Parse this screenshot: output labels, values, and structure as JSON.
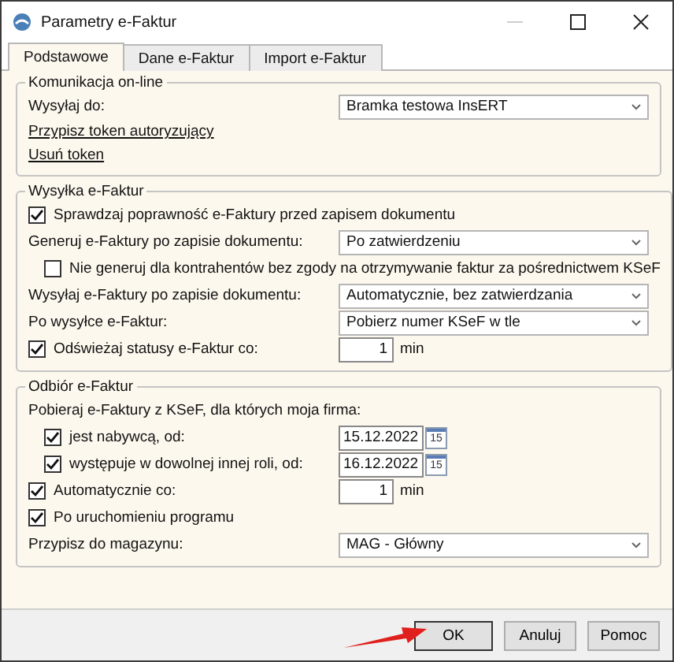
{
  "window": {
    "title": "Parametry e-Faktur"
  },
  "tabs": [
    {
      "label": "Podstawowe",
      "selected": true
    },
    {
      "label": "Dane e-Faktur",
      "selected": false
    },
    {
      "label": "Import e-Faktur",
      "selected": false
    }
  ],
  "sections": [
    {
      "title": "Komunikacja on-line",
      "rows": [
        {
          "kind": "select",
          "label": "Wysyłaj do:",
          "value": "Bramka testowa InsERT"
        },
        {
          "kind": "link",
          "label": "Przypisz token autoryzujący"
        },
        {
          "kind": "link",
          "label": "Usuń token"
        }
      ]
    },
    {
      "title": "Wysyłka e-Faktur",
      "rows": [
        {
          "kind": "checkbox",
          "label": "Sprawdzaj poprawność e-Faktury przed zapisem dokumentu",
          "checked": true
        },
        {
          "kind": "select",
          "label": "Generuj e-Faktury po zapisie dokumentu:",
          "value": "Po zatwierdzeniu"
        },
        {
          "kind": "checkbox",
          "indent": true,
          "label": "Nie generuj dla kontrahentów bez zgody na otrzymywanie faktur za pośrednictwem KSeF",
          "checked": false
        },
        {
          "kind": "select",
          "label": "Wysyłaj e-Faktury po zapisie dokumentu:",
          "value": "Automatycznie, bez zatwierdzania"
        },
        {
          "kind": "select",
          "label": "Po wysyłce e-Faktur:",
          "value": "Pobierz numer KSeF w tle"
        },
        {
          "kind": "number",
          "label": "Odświeżaj statusy e-Faktur co:",
          "checked": true,
          "value": "1",
          "unit": "min"
        }
      ]
    },
    {
      "title": "Odbiór  e-Faktur",
      "rows": [
        {
          "kind": "label",
          "label": "Pobieraj e-Faktury z KSeF, dla których moja firma:"
        },
        {
          "kind": "date",
          "indent": true,
          "label": "jest nabywcą, od:",
          "checked": true,
          "value": "15.12.2022",
          "icon_text": "15"
        },
        {
          "kind": "date",
          "indent": true,
          "label": "występuje w dowolnej innej roli, od:",
          "checked": true,
          "value": "16.12.2022",
          "icon_text": "15"
        },
        {
          "kind": "number",
          "label": "Automatycznie co:",
          "checked": true,
          "value": "1",
          "unit": "min"
        },
        {
          "kind": "checkbox",
          "label": "Po uruchomieniu programu",
          "checked": true
        },
        {
          "kind": "select",
          "label": "Przypisz do magazynu:",
          "value": "MAG - Główny"
        }
      ]
    }
  ],
  "buttons": [
    {
      "label": "OK",
      "selected": true
    },
    {
      "label": "Anuluj",
      "selected": false
    },
    {
      "label": "Pomoc",
      "selected": false
    }
  ]
}
